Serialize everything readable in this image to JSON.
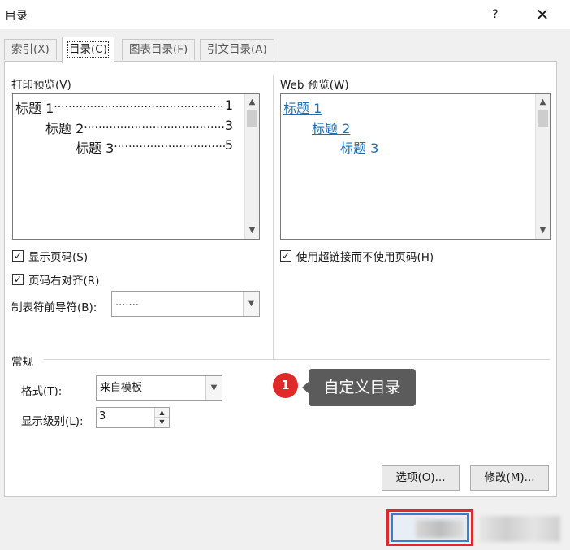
{
  "dialog": {
    "title": "目录",
    "help_label": "?",
    "close_label": "✕"
  },
  "tabs": [
    {
      "label": "索引(X)"
    },
    {
      "label": "目录(C)"
    },
    {
      "label": "图表目录(F)"
    },
    {
      "label": "引文目录(A)"
    }
  ],
  "print_preview": {
    "label": "打印预览(V)",
    "entries": [
      {
        "text": "标题 1",
        "page": "1"
      },
      {
        "text": "标题 2",
        "page": "3"
      },
      {
        "text": "标题 3",
        "page": "5"
      }
    ]
  },
  "web_preview": {
    "label": "Web 预览(W)",
    "entries": [
      "标题 1",
      "标题 2",
      "标题 3"
    ]
  },
  "options": {
    "show_page_numbers": "显示页码(S)",
    "right_align": "页码右对齐(R)",
    "tab_leader_label": "制表符前导符(B):",
    "tab_leader_value": ".......",
    "use_hyperlinks": "使用超链接而不使用页码(H)"
  },
  "general": {
    "section_label": "常规",
    "format_label": "格式(T):",
    "format_value": "来自模板",
    "levels_label": "显示级别(L):",
    "levels_value": "3"
  },
  "buttons": {
    "options": "选项(O)...",
    "modify": "修改(M)..."
  },
  "callout": {
    "number": "1",
    "text": "自定义目录"
  },
  "icons": {
    "scroll_up": "▲",
    "scroll_down": "▼",
    "combo_arrow": "▼",
    "check": "✓"
  }
}
